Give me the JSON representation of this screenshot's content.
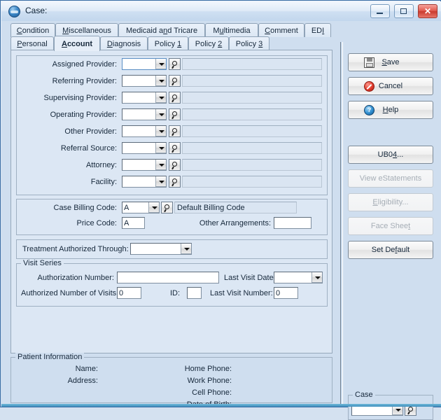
{
  "window": {
    "title": "Case:",
    "icon": "case-app-icon",
    "controls": {
      "minimize": "minimize-icon",
      "maximize": "maximize-icon",
      "close": "✕"
    }
  },
  "tabs": {
    "row1": [
      {
        "label": "Condition",
        "accel": "C",
        "selected": false
      },
      {
        "label": "Miscellaneous",
        "accel": "M",
        "selected": false
      },
      {
        "label": "Medicaid and Tricare",
        "accel": "n",
        "selected": false
      },
      {
        "label": "Multimedia",
        "accel": "u",
        "selected": false
      },
      {
        "label": "Comment",
        "accel": "C",
        "selected": false
      },
      {
        "label": "EDI",
        "accel": "I",
        "selected": false
      }
    ],
    "row2": [
      {
        "label": "Personal",
        "accel": "P",
        "selected": false
      },
      {
        "label": "Account",
        "accel": "A",
        "selected": true
      },
      {
        "label": "Diagnosis",
        "accel": "D",
        "selected": false
      },
      {
        "label": "Policy 1",
        "accel": "1",
        "selected": false
      },
      {
        "label": "Policy 2",
        "accel": "2",
        "selected": false
      },
      {
        "label": "Policy 3",
        "accel": "3",
        "selected": false
      }
    ]
  },
  "providers": {
    "rows": [
      {
        "label": "Assigned Provider:",
        "value": "",
        "display": ""
      },
      {
        "label": "Referring Provider:",
        "value": "",
        "display": ""
      },
      {
        "label": "Supervising Provider:",
        "value": "",
        "display": ""
      },
      {
        "label": "Operating Provider:",
        "value": "",
        "display": ""
      },
      {
        "label": "Other Provider:",
        "value": "",
        "display": ""
      },
      {
        "label": "Referral Source:",
        "value": "",
        "display": ""
      },
      {
        "label": "Attorney:",
        "value": "",
        "display": ""
      },
      {
        "label": "Facility:",
        "value": "",
        "display": ""
      }
    ]
  },
  "billing": {
    "case_billing_code_label": "Case Billing Code:",
    "case_billing_code_value": "A",
    "case_billing_code_description": "Default Billing Code",
    "price_code_label": "Price Code:",
    "price_code_value": "A",
    "other_arrangements_label": "Other Arrangements:",
    "other_arrangements_value": ""
  },
  "treatment": {
    "label": "Treatment Authorized Through:",
    "value": ""
  },
  "visit_series": {
    "group_label": "Visit Series",
    "authorization_number_label": "Authorization Number:",
    "authorization_number_value": "",
    "last_visit_date_label": "Last Visit Date:",
    "last_visit_date_value": "",
    "authorized_number_of_visits_label": "Authorized Number of Visits:",
    "authorized_number_of_visits_value": "0",
    "id_label": "ID:",
    "id_value": "",
    "last_visit_number_label": "Last Visit Number:",
    "last_visit_number_value": "0"
  },
  "patient_information": {
    "group_label": "Patient Information",
    "name_label": "Name:",
    "name_value": "",
    "address_label": "Address:",
    "address_value": "",
    "home_phone_label": "Home Phone:",
    "home_phone_value": "",
    "work_phone_label": "Work Phone:",
    "work_phone_value": "",
    "cell_phone_label": "Cell Phone:",
    "cell_phone_value": "",
    "date_of_birth_label": "Date of Birth:",
    "date_of_birth_value": ""
  },
  "buttons": [
    {
      "name": "save",
      "label": "Save",
      "pre": "",
      "accel": "S",
      "post": "ave",
      "icon": "floppy-disk-icon",
      "disabled": false
    },
    {
      "name": "cancel",
      "label": "Cancel",
      "pre": "Cancel",
      "accel": "",
      "post": "",
      "icon": "cancel-circle-icon",
      "disabled": false
    },
    {
      "name": "help",
      "label": "Help",
      "pre": "",
      "accel": "H",
      "post": "elp",
      "icon": "help-circle-icon",
      "disabled": false
    },
    {
      "name": "ub04",
      "label": "UB04...",
      "pre": "UB0",
      "accel": "4",
      "post": "...",
      "icon": "",
      "disabled": false
    },
    {
      "name": "view-estatements",
      "label": "View eStatements",
      "pre": "View eStatements",
      "accel": "",
      "post": "",
      "icon": "",
      "disabled": true
    },
    {
      "name": "eligibility",
      "label": "Eligibility...",
      "pre": "",
      "accel": "E",
      "post": "ligibility...",
      "icon": "",
      "disabled": true
    },
    {
      "name": "face-sheet",
      "label": "Face Sheet",
      "pre": "Face Shee",
      "accel": "t",
      "post": "",
      "icon": "",
      "disabled": true
    },
    {
      "name": "set-default",
      "label": "Set Default",
      "pre": "Set De",
      "accel": "f",
      "post": "ault",
      "icon": "",
      "disabled": false
    }
  ],
  "case_selector": {
    "group_label": "Case",
    "value": ""
  },
  "colors": {
    "window_border": "#3b6ea5",
    "panel_bg": "#dce7f4",
    "client_bg": "#cfdeef",
    "close_button": "#c93a2d",
    "status_strip": "#3f8fbd"
  }
}
